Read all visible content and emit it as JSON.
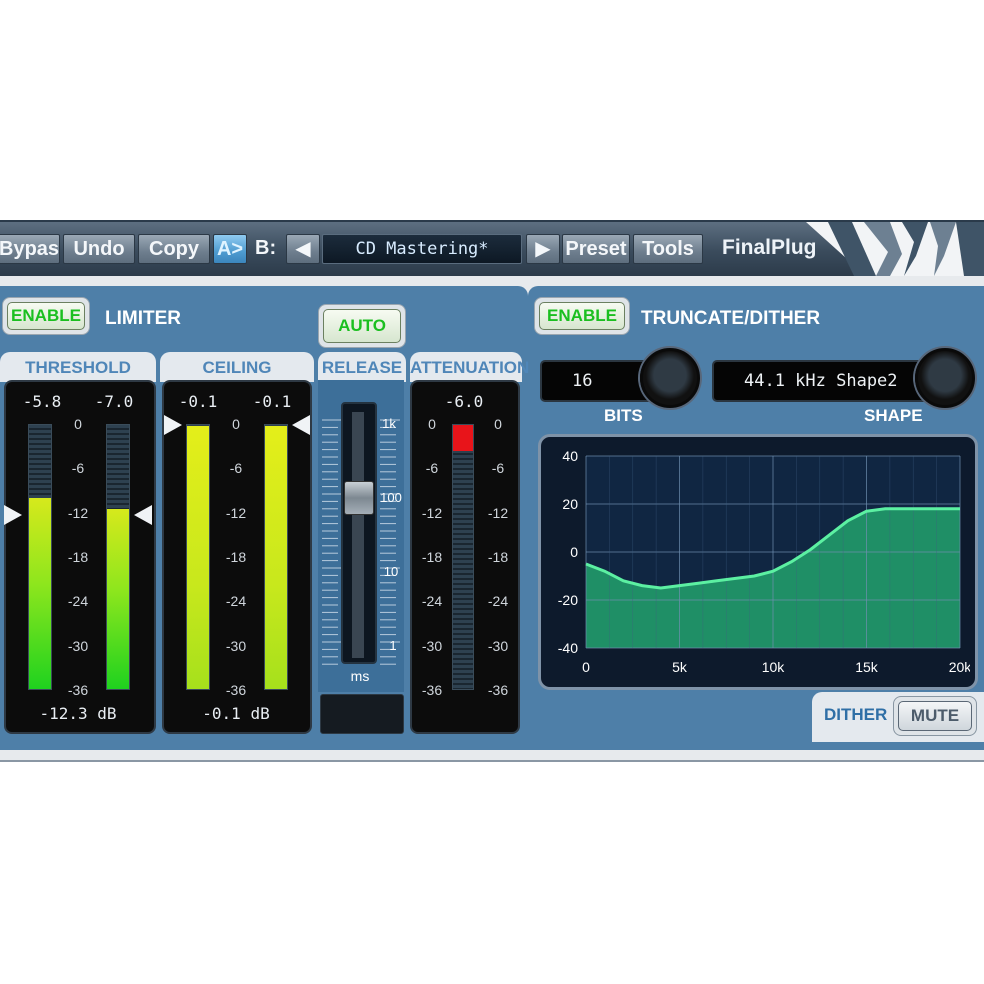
{
  "toolbar": {
    "bypass": "Bypass",
    "undo": "Undo",
    "copy": "Copy",
    "ab_a": "A>",
    "ab_b": "B:",
    "prev_arrow": "◀",
    "preset_name": "CD Mastering*",
    "next_arrow": "▶",
    "preset": "Preset",
    "tools": "Tools",
    "product": "FinalPlug"
  },
  "limiter": {
    "enable_label": "ENABLE",
    "title": "LIMITER",
    "auto_label": "AUTO",
    "threshold": {
      "label": "THRESHOLD",
      "left_value": "-5.8",
      "right_value": "-7.0",
      "readout": "-12.3 dB",
      "left_level_db": -10,
      "right_level_db": -11.5,
      "arrow_db": -12.3
    },
    "ceiling": {
      "label": "CEILING",
      "left_value": "-0.1",
      "right_value": "-0.1",
      "readout": "-0.1 dB",
      "left_level_db": -0.1,
      "right_level_db": -0.1,
      "arrow_db": -0.1
    },
    "release": {
      "label": "RELEASE",
      "scale": [
        "1k",
        "100",
        "10",
        "1"
      ],
      "unit": "ms",
      "slider_position": 100
    },
    "attenuation": {
      "label": "ATTENUATION",
      "value": "-6.0",
      "level_db": -3.5
    },
    "scale": [
      "0",
      "-6",
      "-12",
      "-18",
      "-24",
      "-30",
      "-36"
    ]
  },
  "dither": {
    "enable_label": "ENABLE",
    "title": "TRUNCATE/DITHER",
    "bits_value": "16",
    "bits_label": "BITS",
    "shape_value": "44.1 kHz Shape2",
    "shape_label": "SHAPE",
    "dither_label": "DITHER",
    "mute_label": "MUTE"
  },
  "chart_data": {
    "type": "area",
    "x_ticks": [
      "0",
      "5k",
      "10k",
      "15k",
      "20k"
    ],
    "y_ticks": [
      "40",
      "20",
      "0",
      "-20",
      "-40"
    ],
    "xlim": [
      0,
      20000
    ],
    "ylim": [
      -40,
      40
    ],
    "grid": true,
    "x": [
      0,
      1000,
      2000,
      3000,
      4000,
      5000,
      6000,
      7000,
      8000,
      9000,
      10000,
      11000,
      12000,
      13000,
      14000,
      15000,
      16000,
      17000,
      18000,
      19000,
      20000
    ],
    "y": [
      -5,
      -8,
      -12,
      -14,
      -15,
      -14,
      -13,
      -12,
      -11,
      -10,
      -8,
      -4,
      1,
      7,
      13,
      17,
      18,
      18,
      18,
      18,
      18
    ],
    "line_color": "#5cf0a2",
    "fill_color": "#1f8f66"
  }
}
